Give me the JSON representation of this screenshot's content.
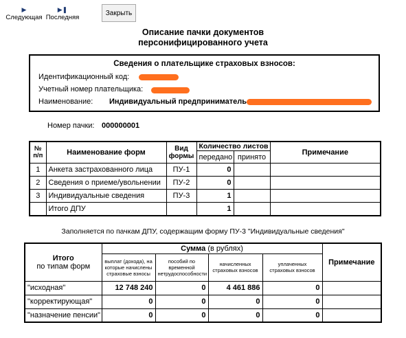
{
  "toolbar": {
    "next_label": "Следующая",
    "last_label": "Последняя",
    "close_label": "Закрыть"
  },
  "title": {
    "line1": "Описание пачки документов",
    "line2": "персонифицированного учета"
  },
  "payer": {
    "header": "Сведения о плательщике страховых взносов:",
    "id_label": "Идентификационный код:",
    "reg_label": "Учетный номер плательщика:",
    "name_label": "Наименование:",
    "name_value": "Индивидуальный предприниматель"
  },
  "batch": {
    "label": "Номер пачки:",
    "value": "000000001"
  },
  "forms_table": {
    "headers": {
      "num": "№ п/п",
      "name": "Наименование форм",
      "type": "Вид формы",
      "sheets": "Количество листов",
      "sent": "передано",
      "accepted": "принято",
      "note": "Примечание"
    },
    "rows": [
      {
        "num": "1",
        "name": "Анкета застрахованного лица",
        "type": "ПУ-1",
        "sent": "0",
        "accepted": ""
      },
      {
        "num": "2",
        "name": "Сведения о приеме/увольнении",
        "type": "ПУ-2",
        "sent": "0",
        "accepted": ""
      },
      {
        "num": "3",
        "name": "Индивидуальные сведения",
        "type": "ПУ-3",
        "sent": "1",
        "accepted": ""
      },
      {
        "num": "",
        "name": "Итого ДПУ",
        "type": "",
        "sent": "1",
        "accepted": ""
      }
    ]
  },
  "note_line": "Заполняется по пачкам ДПУ, содержащим форму ПУ-3 \"Индивидуальные сведения\"",
  "sums_table": {
    "headers": {
      "total_bold": "Итого",
      "total_rest": "по типам форм",
      "sum_bold": "Сумма",
      "sum_rest": " (в рублях)",
      "col1": "выплат (дохода), на которые начислены страховые взносы",
      "col2": "пособий по временной нетрудоспособности",
      "col3": "начисленных страховых взносов",
      "col4": "уплаченных страховых взносов",
      "note": "Примечание"
    },
    "rows": [
      {
        "type": "\"исходная\"",
        "v1": "12 748 240",
        "v2": "0",
        "v3": "4 461 886",
        "v4": "0"
      },
      {
        "type": "\"корректирующая\"",
        "v1": "0",
        "v2": "0",
        "v3": "0",
        "v4": "0"
      },
      {
        "type": "\"назначение пенсии\"",
        "v1": "0",
        "v2": "0",
        "v3": "0",
        "v4": "0"
      }
    ]
  }
}
